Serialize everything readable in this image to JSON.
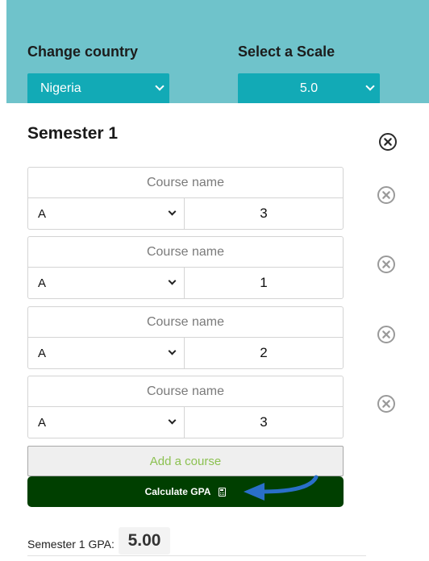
{
  "controls": {
    "country_label": "Change country",
    "country_value": "Nigeria",
    "scale_label": "Select a Scale",
    "scale_value": "5.0"
  },
  "semester": {
    "title": "Semester 1",
    "courses": [
      {
        "name_placeholder": "Course name",
        "grade": "A",
        "credit": "3"
      },
      {
        "name_placeholder": "Course name",
        "grade": "A",
        "credit": "1"
      },
      {
        "name_placeholder": "Course name",
        "grade": "A",
        "credit": "2"
      },
      {
        "name_placeholder": "Course name",
        "grade": "A",
        "credit": "3"
      }
    ],
    "add_course_label": "Add a course",
    "calculate_label": "Calculate GPA",
    "gpa_label": "Semester 1 GPA:",
    "gpa_value": "5.00"
  },
  "colors": {
    "header_bg": "#6fc3cb",
    "select_bg": "#12aab6",
    "calculate_bg": "#003f00",
    "add_course_text": "#8cc151",
    "annotation_arrow": "#2a6fc9"
  },
  "icons": {
    "remove_semester": "close-circle-icon",
    "remove_course": "close-circle-icon",
    "calculate": "calculator-icon",
    "dropdown": "chevron-down-icon"
  }
}
